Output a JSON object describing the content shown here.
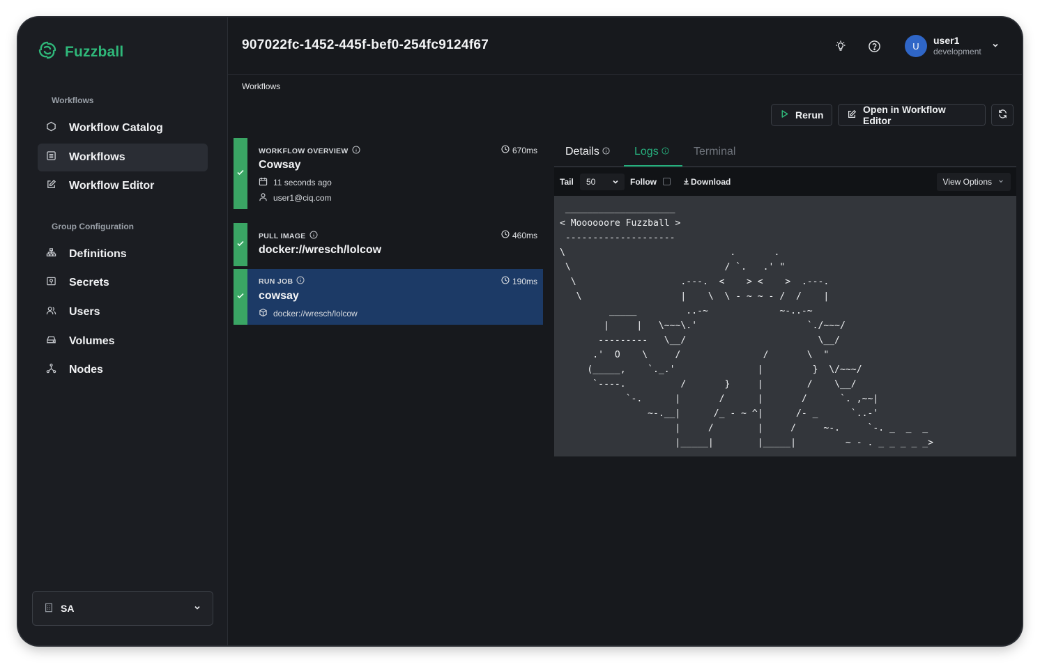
{
  "app": {
    "name": "Fuzzball"
  },
  "sidebar": {
    "sections": [
      {
        "label": "Workflows"
      },
      {
        "label": "Group Configuration"
      }
    ],
    "items": [
      {
        "label": "Workflow Catalog"
      },
      {
        "label": "Workflows"
      },
      {
        "label": "Workflow Editor"
      },
      {
        "label": "Definitions"
      },
      {
        "label": "Secrets"
      },
      {
        "label": "Users"
      },
      {
        "label": "Volumes"
      },
      {
        "label": "Nodes"
      }
    ],
    "org_select": {
      "value": "SA"
    }
  },
  "header": {
    "title": "907022fc-1452-445f-bef0-254fc9124f67",
    "user": {
      "initial": "U",
      "name": "user1",
      "environment": "development"
    }
  },
  "breadcrumb": {
    "current": "Workflows"
  },
  "actions": {
    "rerun": "Rerun",
    "open_editor": "Open in Workflow Editor"
  },
  "steps": [
    {
      "kind": "WORKFLOW OVERVIEW",
      "name": "Cowsay",
      "duration": "670ms",
      "time": "11 seconds ago",
      "user": "user1@ciq.com"
    },
    {
      "kind": "PULL IMAGE",
      "name": "docker://wresch/lolcow",
      "duration": "460ms"
    },
    {
      "kind": "RUN JOB",
      "name": "cowsay",
      "duration": "190ms",
      "image": "docker://wresch/lolcow"
    }
  ],
  "tabs": [
    {
      "label": "Details"
    },
    {
      "label": "Logs"
    },
    {
      "label": "Terminal"
    }
  ],
  "log_toolbar": {
    "tail_label": "Tail",
    "tail_value": "50",
    "follow_label": "Follow",
    "download_label": "Download",
    "view_options_label": "View Options"
  },
  "log": {
    "text": " ____________________\n< Moooooore Fuzzball >\n --------------------\n\\                              .       .\n \\                            / `.   .' \"\n  \\                   .---.  <    > <    >  .---.\n   \\                  |    \\  \\ - ~ ~ - /  /    |\n         _____         ..-~             ~-..-~\n        |     |   \\~~~\\.'                    `./~~~/\n       ---------   \\__/                        \\__/\n      .'  O    \\     /               /       \\  \"\n     (_____,    `._.'               |         }  \\/~~~/\n      `----.          /       }     |        /    \\__/\n            `-.      |       /      |       /      `. ,~~|\n                ~-.__|      /_ - ~ ^|      /- _      `..-'\n                     |     /        |     /     ~-.     `-. _  _  _\n                     |_____|        |_____|         ~ - . _ _ _ _ _>"
  }
}
